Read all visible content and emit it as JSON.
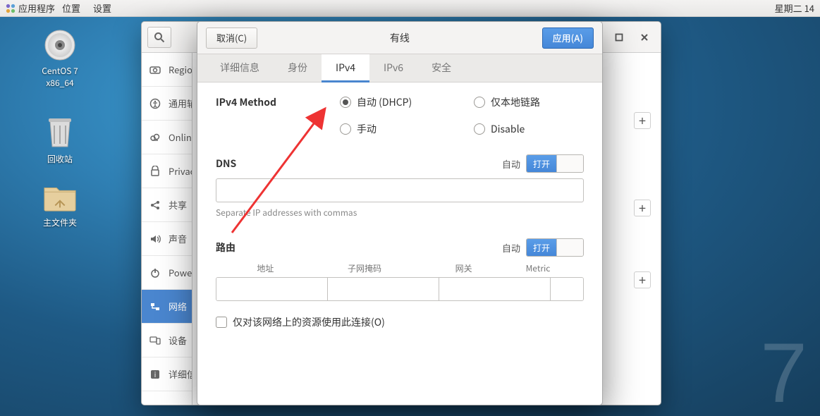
{
  "panel": {
    "apps": "应用程序",
    "places": "位置",
    "settings": "设置",
    "clock": "星期二  14"
  },
  "desktop": {
    "cd_line1": "CentOS 7",
    "cd_line2": "x86_64",
    "trash": "回收站",
    "home": "主文件夹"
  },
  "settings_win": {
    "sidebar": [
      {
        "icon": "camera",
        "label": "Region"
      },
      {
        "icon": "universal",
        "label": "通用辅"
      },
      {
        "icon": "cloud",
        "label": "Online"
      },
      {
        "icon": "privacy",
        "label": "Privacy"
      },
      {
        "icon": "share",
        "label": "共享"
      },
      {
        "icon": "sound",
        "label": "声音"
      },
      {
        "icon": "power",
        "label": "Power"
      },
      {
        "icon": "network",
        "label": "网络"
      },
      {
        "icon": "devices",
        "label": "设备"
      },
      {
        "icon": "info",
        "label": "详细信"
      }
    ],
    "plus": "+"
  },
  "dialog": {
    "cancel": "取消(C)",
    "apply": "应用(A)",
    "title": "有线",
    "tabs": {
      "details": "详细信息",
      "identity": "身份",
      "ipv4": "IPv4",
      "ipv6": "IPv6",
      "security": "安全"
    },
    "ipv4": {
      "method_label": "IPv4 Method",
      "rb_auto": "自动 (DHCP)",
      "rb_local": "仅本地链路",
      "rb_manual": "手动",
      "rb_disable": "Disable",
      "dns_label": "DNS",
      "auto_label": "自动",
      "toggle_on": "打开",
      "dns_hint": "Separate IP addresses with commas",
      "routes_label": "路由",
      "route_cols": {
        "addr": "地址",
        "mask": "子网掩码",
        "gw": "网关",
        "metric": "Metric"
      },
      "only_this": "仅对该网络上的资源使用此连接(O)"
    }
  }
}
